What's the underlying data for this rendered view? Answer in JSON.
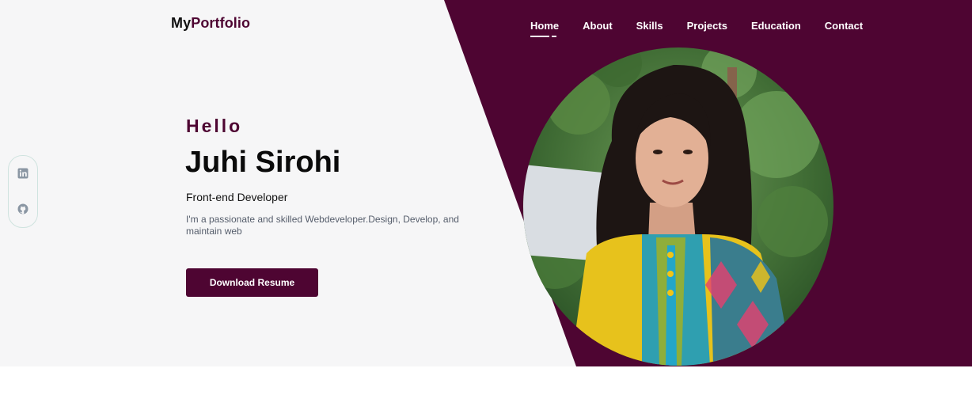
{
  "brand": {
    "prefix": "My",
    "accent": "Portfolio"
  },
  "nav": {
    "items": [
      "Home",
      "About",
      "Skills",
      "Projects",
      "Education",
      "Contact"
    ],
    "active": "Home"
  },
  "social": {
    "icons": [
      "linkedin-icon",
      "github-icon"
    ]
  },
  "hero": {
    "greeting": "Hello",
    "name": "Juhi Sirohi",
    "role": "Front-end Developer",
    "description": "I'm a passionate and skilled Webdeveloper.Design, Develop, and maintain web",
    "cta_label": "Download Resume"
  },
  "colors": {
    "brand": "#4e0532",
    "hero_light": "#f6f6f7",
    "text_dark": "#0b0b0b",
    "text_muted": "#555d6b"
  }
}
